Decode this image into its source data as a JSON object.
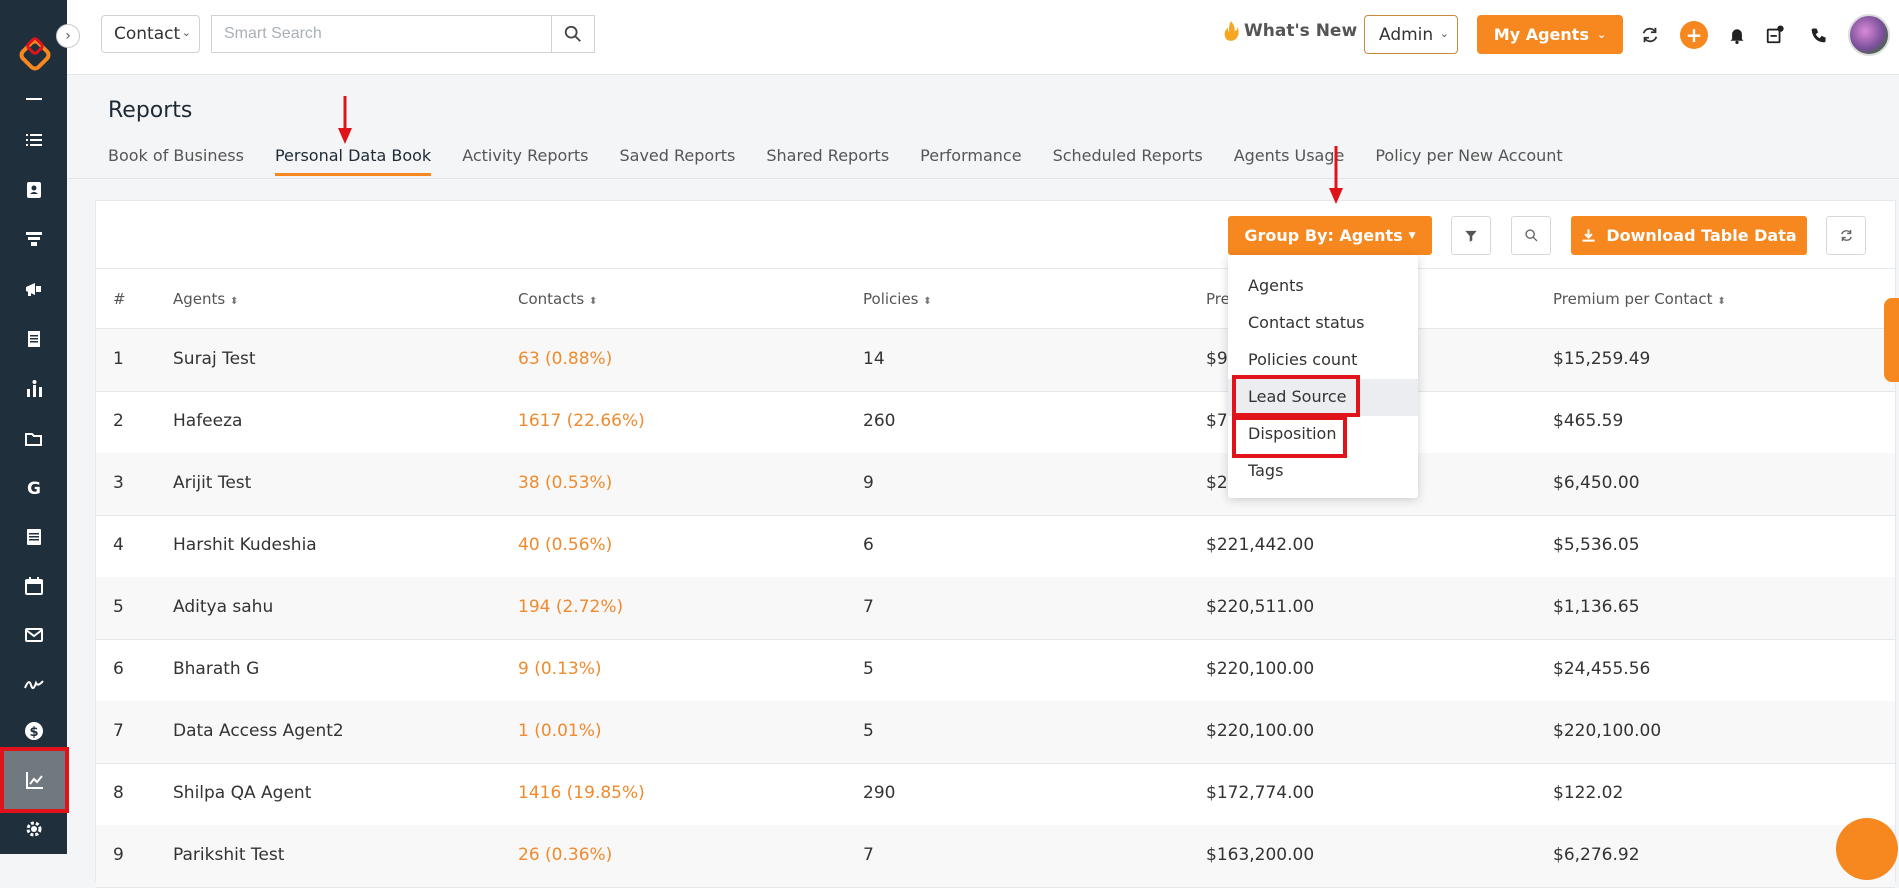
{
  "topbar": {
    "contact_select": "Contact",
    "search_placeholder": "Smart Search",
    "whats_new": "What's New",
    "admin_select": "Admin",
    "agents_button": "My Agents"
  },
  "page": {
    "title": "Reports",
    "tabs": [
      "Book of Business",
      "Personal Data Book",
      "Activity Reports",
      "Saved Reports",
      "Shared Reports",
      "Performance",
      "Scheduled Reports",
      "Agents Usage",
      "Policy per New Account"
    ],
    "active_tab": "Personal Data Book"
  },
  "toolbar": {
    "group_by": "Group By: Agents",
    "download": "Download Table Data"
  },
  "dropdown": {
    "items": [
      "Agents",
      "Contact status",
      "Policies count",
      "Lead Source",
      "Disposition",
      "Tags"
    ],
    "highlighted": "Lead Source"
  },
  "table": {
    "headers": [
      "#",
      "Agents",
      "Contacts",
      "Policies",
      "Pre",
      "Premium per Contact"
    ],
    "rows": [
      {
        "n": "1",
        "agent": "Suraj Test",
        "contacts": "63 (0.88%)",
        "policies": "14",
        "premium": "$9",
        "per_contact": "$15,259.49"
      },
      {
        "n": "2",
        "agent": "Hafeeza",
        "contacts": "1617 (22.66%)",
        "policies": "260",
        "premium": "$7",
        "per_contact": "$465.59"
      },
      {
        "n": "3",
        "agent": "Arijit Test",
        "contacts": "38 (0.53%)",
        "policies": "9",
        "premium": "$2",
        "per_contact": "$6,450.00"
      },
      {
        "n": "4",
        "agent": "Harshit Kudeshia",
        "contacts": "40 (0.56%)",
        "policies": "6",
        "premium": "$221,442.00",
        "per_contact": "$5,536.05"
      },
      {
        "n": "5",
        "agent": "Aditya sahu",
        "contacts": "194 (2.72%)",
        "policies": "7",
        "premium": "$220,511.00",
        "per_contact": "$1,136.65"
      },
      {
        "n": "6",
        "agent": "Bharath G",
        "contacts": "9 (0.13%)",
        "policies": "5",
        "premium": "$220,100.00",
        "per_contact": "$24,455.56"
      },
      {
        "n": "7",
        "agent": "Data Access Agent2",
        "contacts": "1 (0.01%)",
        "policies": "5",
        "premium": "$220,100.00",
        "per_contact": "$220,100.00"
      },
      {
        "n": "8",
        "agent": "Shilpa QA Agent",
        "contacts": "1416 (19.85%)",
        "policies": "290",
        "premium": "$172,774.00",
        "per_contact": "$122.02"
      },
      {
        "n": "9",
        "agent": "Parikshit Test",
        "contacts": "26 (0.36%)",
        "policies": "7",
        "premium": "$163,200.00",
        "per_contact": "$6,276.92"
      }
    ]
  },
  "colors": {
    "accent": "#f7871f",
    "sidebar": "#1f2f3b",
    "annotation": "#e0131b"
  }
}
